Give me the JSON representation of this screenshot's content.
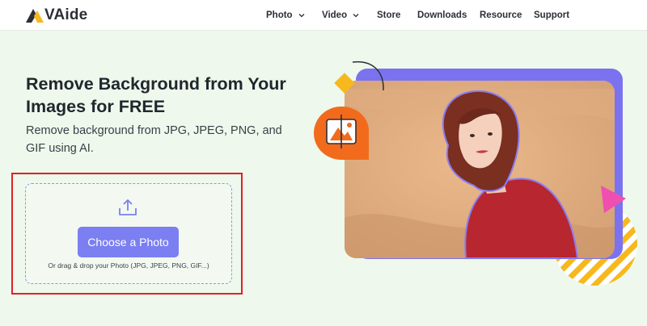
{
  "brand": {
    "logo_text": "VAide",
    "logo_icon": "avaide-logo-icon"
  },
  "nav": {
    "photo": "Photo",
    "video": "Video",
    "store": "Store",
    "downloads": "Downloads",
    "resource": "Resource",
    "support": "Support"
  },
  "hero": {
    "title": "Remove Background from Your Images for FREE",
    "subtitle": "Remove background from JPG, JPEG, PNG, and GIF using AI."
  },
  "upload": {
    "button_label": "Choose a Photo",
    "hint": "Or drag & drop your Photo (JPG, JPEG, PNG, GIF...)",
    "icon": "upload-icon"
  },
  "colors": {
    "accent": "#7b7ff2",
    "highlight": "#e0202a",
    "background": "#eef8ec",
    "orange": "#f26b1d",
    "yellow": "#f7b81e",
    "pink": "#ee4fb0"
  }
}
